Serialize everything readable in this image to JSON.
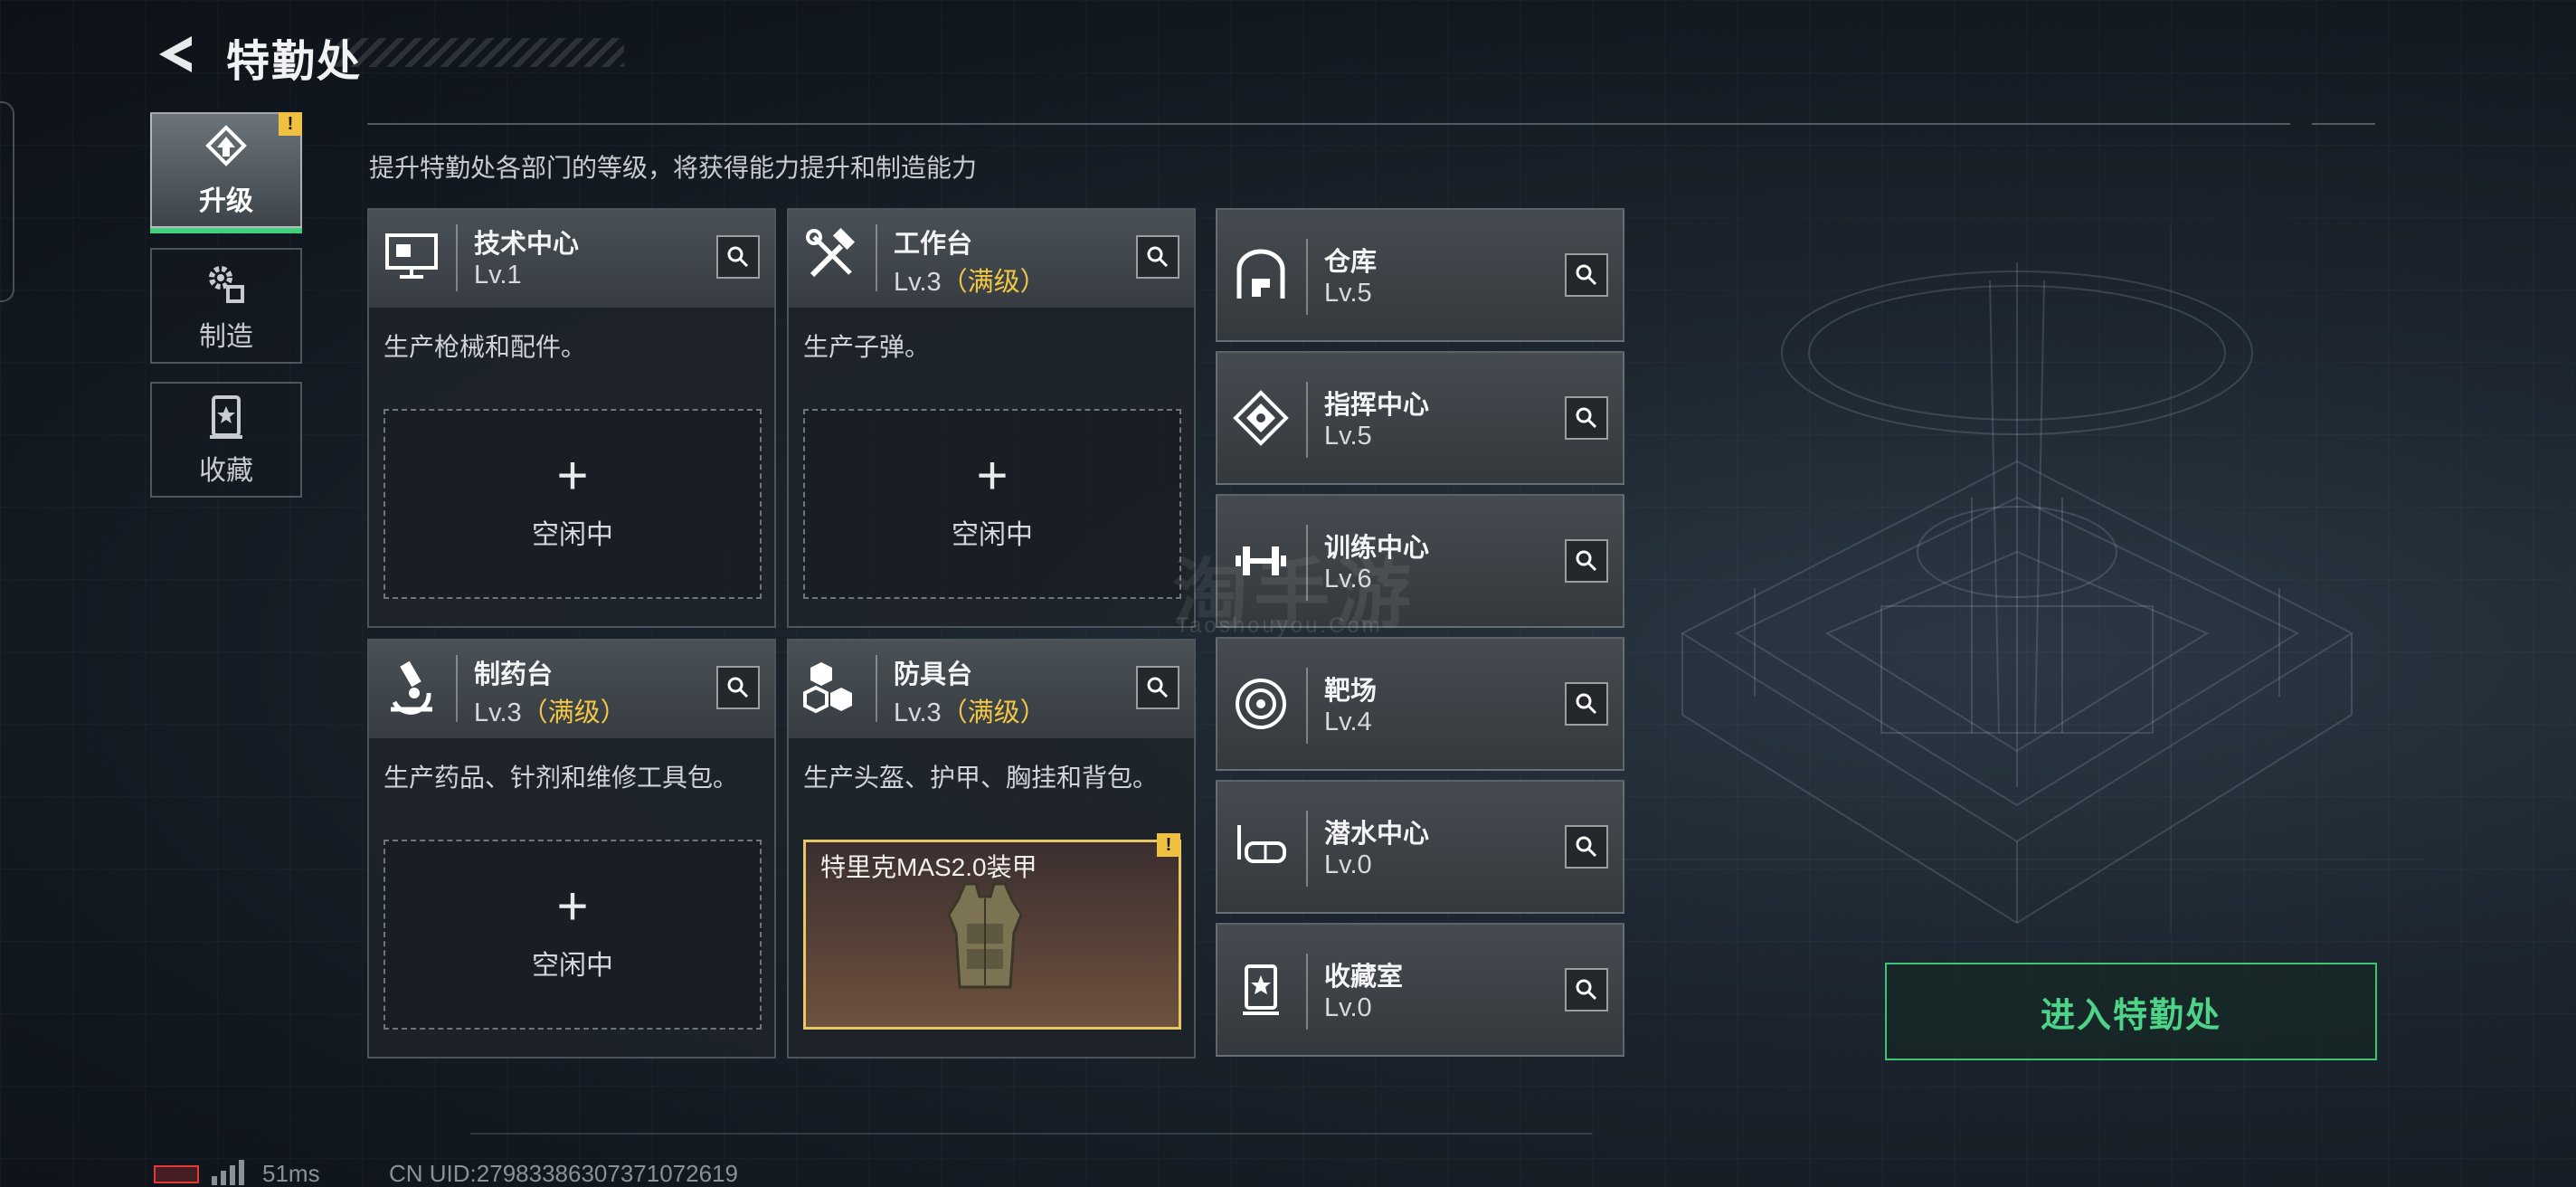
{
  "header": {
    "title": "特勤处"
  },
  "sidebar": {
    "items": [
      {
        "label": "升级",
        "icon": "upgrade-icon",
        "active": true,
        "alert": "!"
      },
      {
        "label": "制造",
        "icon": "gear-icon",
        "active": false
      },
      {
        "label": "收藏",
        "icon": "collection-icon",
        "active": false
      }
    ]
  },
  "description": "提升特勤处各部门的等级，将获得能力提升和制造能力",
  "workshops": [
    {
      "name": "技术中心",
      "level": "Lv.1",
      "max": "",
      "desc": "生产枪械和配件。",
      "slot": {
        "plus": "+",
        "status": "空闲中"
      }
    },
    {
      "name": "工作台",
      "level": "Lv.3",
      "max": "（满级）",
      "desc": "生产子弹。",
      "slot": {
        "plus": "+",
        "status": "空闲中"
      }
    },
    {
      "name": "制药台",
      "level": "Lv.3",
      "max": "（满级）",
      "desc": "生产药品、针剂和维修工具包。",
      "slot": {
        "plus": "+",
        "status": "空闲中"
      }
    },
    {
      "name": "防具台",
      "level": "Lv.3",
      "max": "（满级）",
      "desc": "生产头盔、护甲、胸挂和背包。",
      "slot": {
        "item": "特里克MAS2.0装甲",
        "alert": "!"
      }
    }
  ],
  "facilities": [
    {
      "name": "仓库",
      "level": "Lv.5",
      "icon": "warehouse-icon"
    },
    {
      "name": "指挥中心",
      "level": "Lv.5",
      "icon": "command-center-icon"
    },
    {
      "name": "训练中心",
      "level": "Lv.6",
      "icon": "dumbbell-icon"
    },
    {
      "name": "靶场",
      "level": "Lv.4",
      "icon": "target-icon"
    },
    {
      "name": "潜水中心",
      "level": "Lv.0",
      "icon": "diving-mask-icon"
    },
    {
      "name": "收藏室",
      "level": "Lv.0",
      "icon": "collection-room-icon"
    }
  ],
  "enter_button": "进入特勤处",
  "status_bar": {
    "ping": "51ms",
    "uid": "CN UID:27983386307371072619"
  },
  "watermark": {
    "main": "淘手游",
    "sub": "Taoshouyou.Com"
  },
  "colors": {
    "accent_green": "#43d07d",
    "max_level": "#f2c744",
    "alert": "#f0c040",
    "battery_low": "#e53935"
  }
}
